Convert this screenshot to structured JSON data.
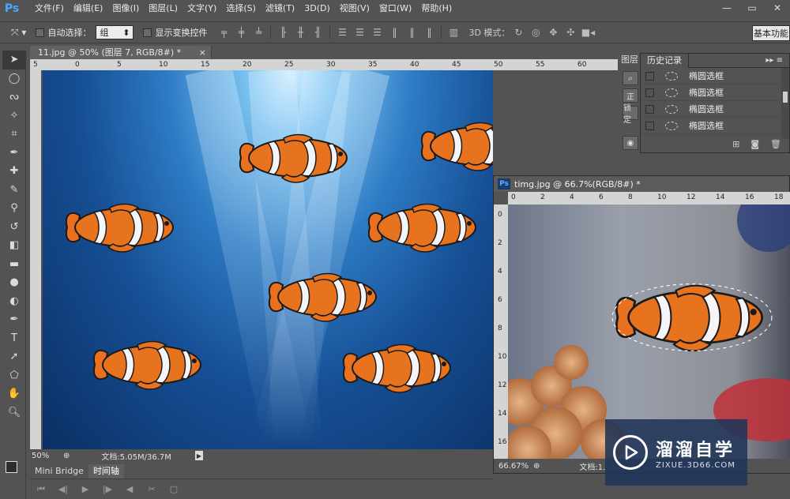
{
  "app": {
    "logo": "Ps",
    "menu": [
      "文件(F)",
      "编辑(E)",
      "图像(I)",
      "图层(L)",
      "文字(Y)",
      "选择(S)",
      "滤镜(T)",
      "3D(D)",
      "视图(V)",
      "窗口(W)",
      "帮助(H)"
    ],
    "window_controls": [
      "—",
      "▭",
      "✕"
    ]
  },
  "options": {
    "tool_icon": "move-tool-icon",
    "auto_select_label": "自动选择：",
    "auto_select_value": "组",
    "show_transform_label": "显示变换控件",
    "mode3d_label": "3D 模式：",
    "workspace_label": "基本功能"
  },
  "tools": [
    "move",
    "ellipse-marquee",
    "lasso",
    "magic-wand",
    "crop",
    "eyedropper",
    "healing-brush",
    "brush",
    "clone-stamp",
    "history-brush",
    "eraser",
    "gradient",
    "blur",
    "dodge",
    "pen",
    "type",
    "path-selection",
    "shape",
    "hand",
    "zoom"
  ],
  "main_doc": {
    "tab_title": "11.jpg @ 50% (图层 7, RGB/8#) *",
    "tab_close": "×",
    "ruler_labels": [
      "5",
      "0",
      "5",
      "10",
      "15",
      "20",
      "25",
      "30",
      "35",
      "40",
      "45",
      "50",
      "55",
      "60"
    ],
    "zoom": "50%",
    "doc_info": "文档:5.05M/36.7M"
  },
  "history": {
    "side_tab": "图层",
    "title": "历史记录",
    "menu_icon": "▸▸ ≡",
    "entries": [
      "椭圆选框",
      "椭圆选框",
      "椭圆选框",
      "椭圆选框"
    ],
    "footer_icons": [
      "new-document-icon",
      "camera-icon",
      "trash-icon"
    ],
    "layer_ghost_labels": [
      "正",
      "锁定"
    ]
  },
  "doc2": {
    "title": "timg.jpg @ 66.7%(RGB/8#) *",
    "ruler_labels": [
      "0",
      "2",
      "4",
      "6",
      "8",
      "10",
      "12",
      "14",
      "16",
      "18"
    ],
    "vruler_labels": [
      "0",
      "2",
      "4",
      "6",
      "8",
      "10",
      "12",
      "14",
      "16"
    ],
    "zoom": "66.67%",
    "doc_info": "文档:1."
  },
  "bottom": {
    "tabs": [
      "Mini Bridge",
      "时间轴"
    ],
    "controls": [
      "⏮",
      "◀|",
      "▶",
      "|▶",
      "◀",
      "✂",
      "▢"
    ]
  },
  "watermark": {
    "brand": "溜溜自学",
    "url": "ZIXUE.3D66.COM"
  }
}
